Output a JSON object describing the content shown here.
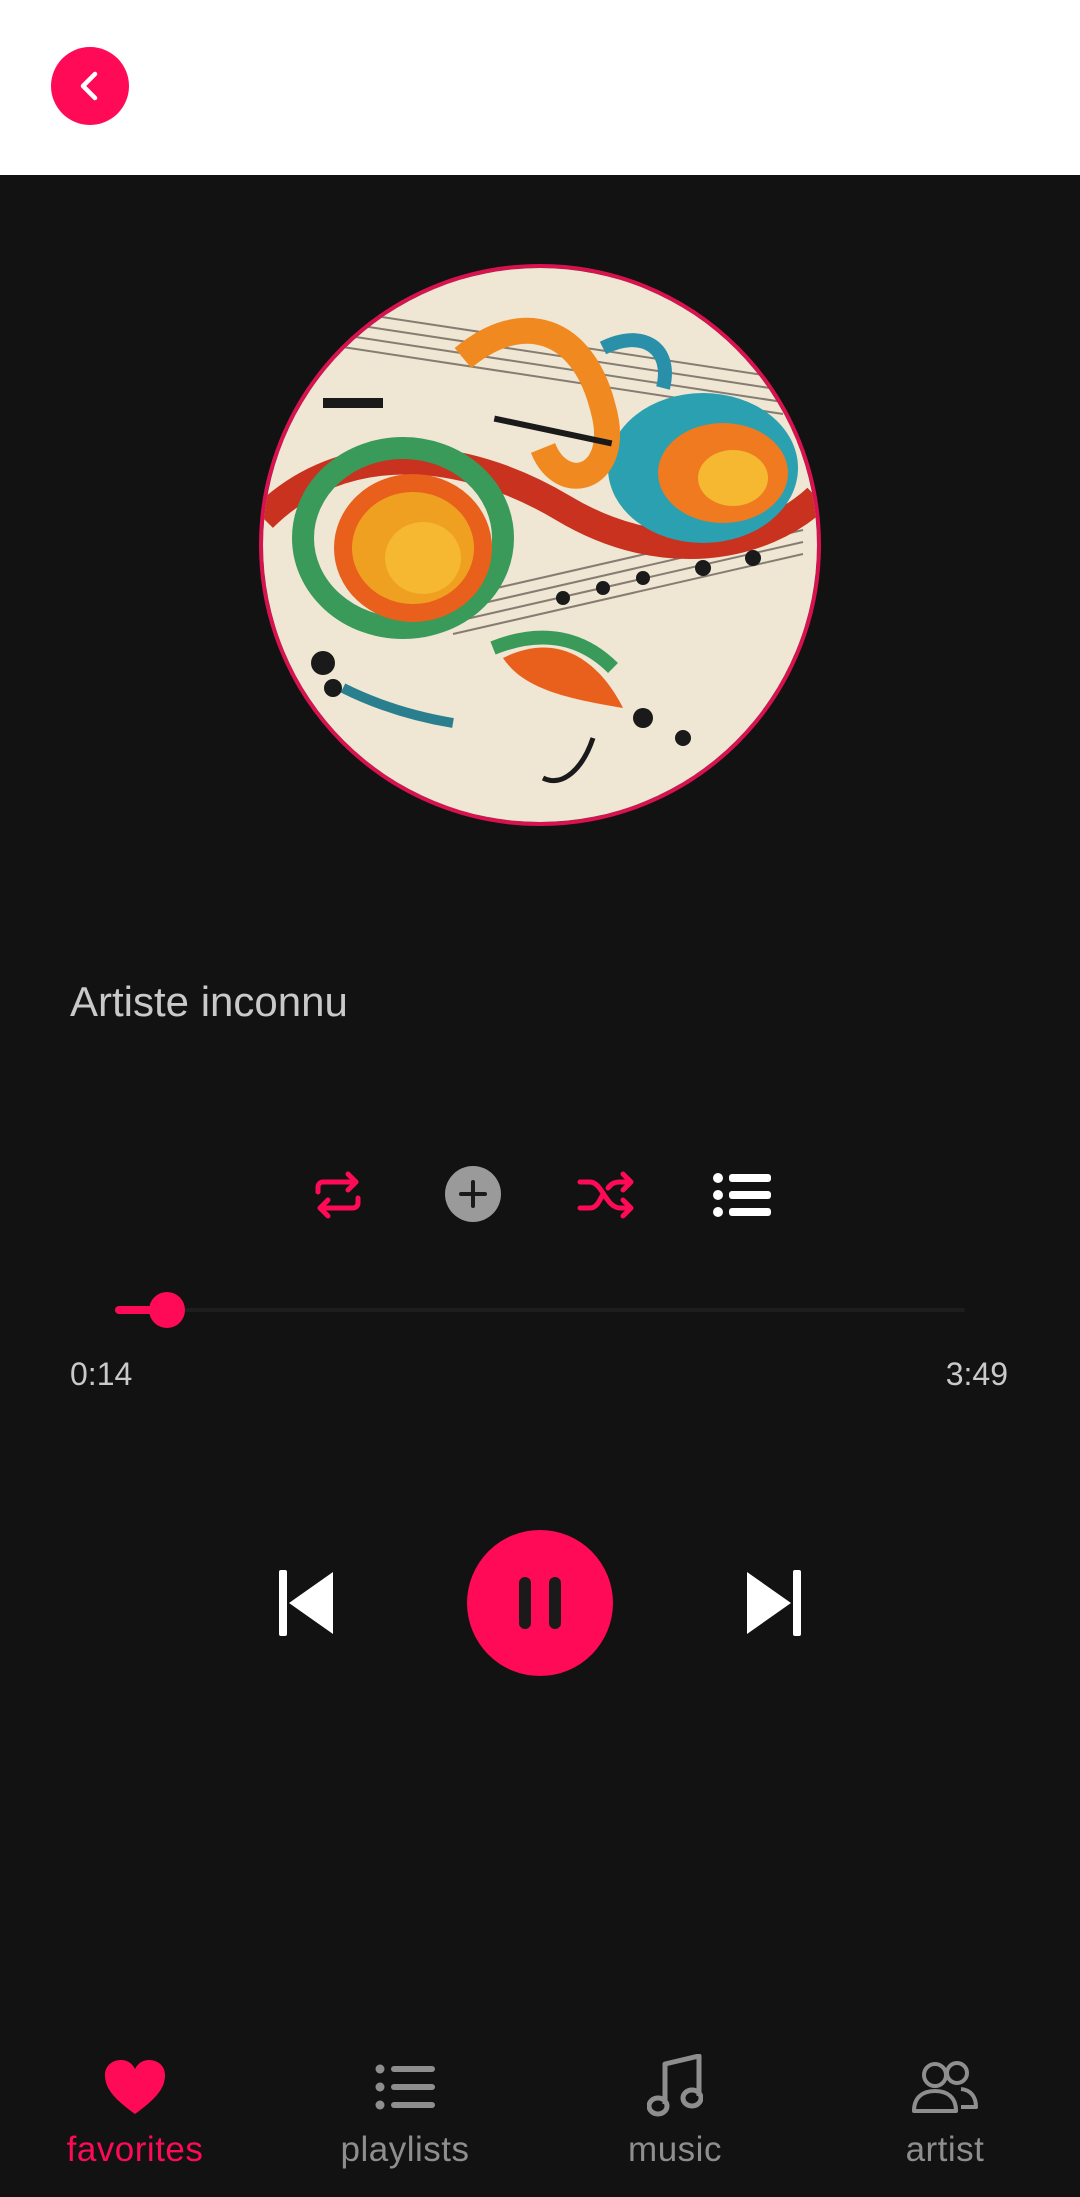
{
  "header": {
    "back_icon": "chevron-left-icon"
  },
  "player": {
    "artist": "Artiste inconnu",
    "elapsed": "0:14",
    "duration": "3:49",
    "progress": 0.061,
    "accent": "#fe0a56"
  },
  "actions": [
    {
      "name": "repeat-icon"
    },
    {
      "name": "add-icon"
    },
    {
      "name": "shuffle-icon"
    },
    {
      "name": "queue-list-icon"
    }
  ],
  "nav": {
    "items": [
      {
        "label": "favorites",
        "icon": "heart-icon",
        "active": true
      },
      {
        "label": "playlists",
        "icon": "list-icon",
        "active": false
      },
      {
        "label": "music",
        "icon": "music-note-icon",
        "active": false
      },
      {
        "label": "artist",
        "icon": "people-icon",
        "active": false
      }
    ]
  }
}
